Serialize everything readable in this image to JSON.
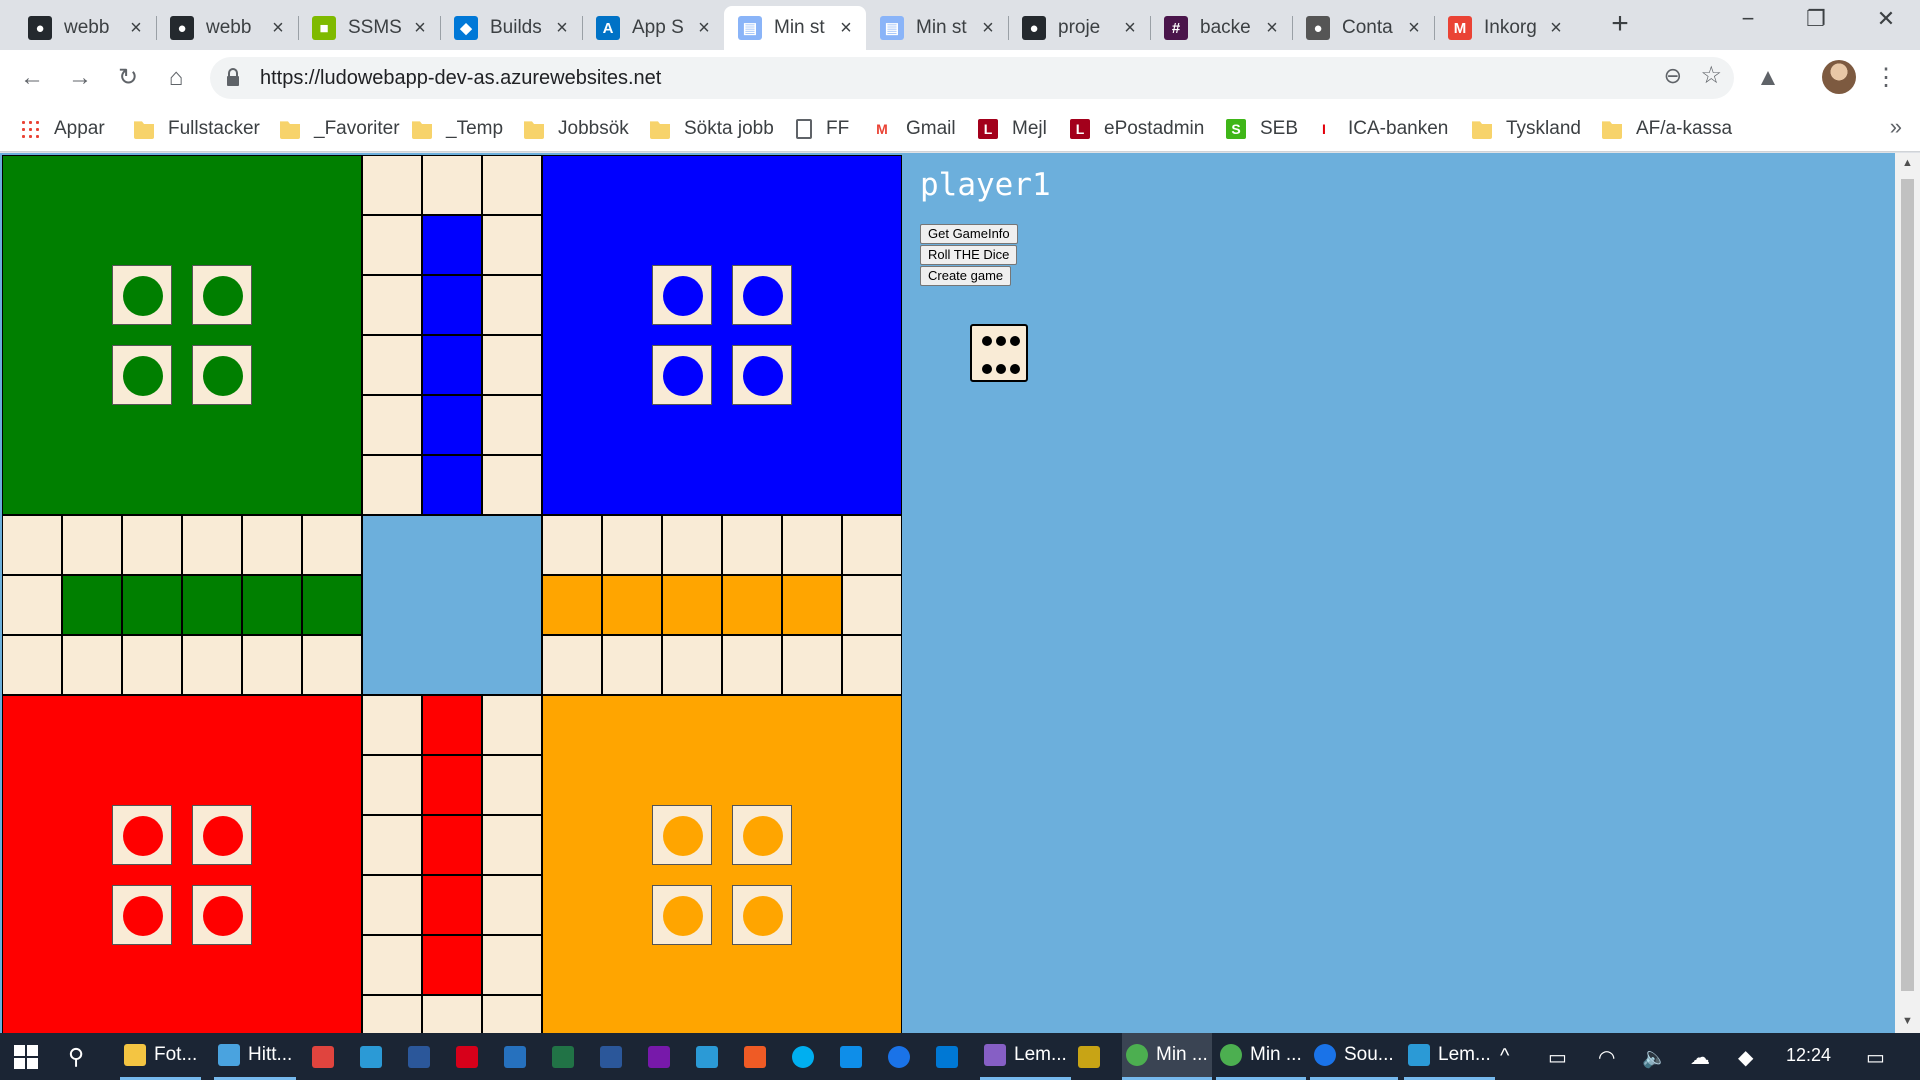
{
  "browser": {
    "tabs": [
      {
        "title": "webb",
        "icon": "github-icon",
        "active": false
      },
      {
        "title": "webb",
        "icon": "github-icon",
        "active": false
      },
      {
        "title": "SSMS",
        "icon": "microsoft-icon",
        "active": false
      },
      {
        "title": "Builds",
        "icon": "azure-devops-icon",
        "active": false
      },
      {
        "title": "App S",
        "icon": "azure-icon",
        "active": false
      },
      {
        "title": "Min st",
        "icon": "page-icon",
        "active": true
      },
      {
        "title": "Min st",
        "icon": "page-icon",
        "active": false
      },
      {
        "title": "proje",
        "icon": "github-icon",
        "active": false
      },
      {
        "title": "backe",
        "icon": "slack-icon",
        "active": false
      },
      {
        "title": "Conta",
        "icon": "apple-icon",
        "active": false
      },
      {
        "title": "Inkorg",
        "icon": "gmail-icon",
        "active": false
      }
    ],
    "url": "https://ludowebapp-dev-as.azurewebsites.net",
    "bookmarks": [
      {
        "label": "Appar",
        "icon": "apps"
      },
      {
        "label": "Fullstacker",
        "icon": "folder"
      },
      {
        "label": "_Favoriter",
        "icon": "folder"
      },
      {
        "label": "_Temp",
        "icon": "folder"
      },
      {
        "label": "Jobbsök",
        "icon": "folder"
      },
      {
        "label": "Sökta jobb",
        "icon": "folder"
      },
      {
        "label": "FF",
        "icon": "doc"
      },
      {
        "label": "Gmail",
        "icon": "gmail"
      },
      {
        "label": "Mejl",
        "icon": "L"
      },
      {
        "label": "ePostadmin",
        "icon": "L"
      },
      {
        "label": "SEB",
        "icon": "seb"
      },
      {
        "label": "ICA-banken",
        "icon": "ica"
      },
      {
        "label": "Tyskland",
        "icon": "folder"
      },
      {
        "label": "AF/a-kassa",
        "icon": "folder"
      }
    ],
    "bookmarks_more": "»"
  },
  "page": {
    "player_name": "player1",
    "buttons": {
      "get_game_info": "Get GameInfo",
      "roll_dice": "Roll THE Dice",
      "create_game": "Create game"
    },
    "dice_value": 6
  },
  "colors": {
    "green": "#007f00",
    "blue": "#0000ff",
    "red": "#ff0000",
    "orange": "#ffa500",
    "square": "#f9ebd6",
    "background": "#6cafdc"
  },
  "taskbar": {
    "items": [
      {
        "label": "Fot...",
        "icon": "explorer-icon",
        "state": "open"
      },
      {
        "label": "Hitt...",
        "icon": "network-icon",
        "state": "open"
      },
      {
        "label": "",
        "icon": "tool-icon",
        "state": "pinned"
      },
      {
        "label": "",
        "icon": "app-icon",
        "state": "pinned"
      },
      {
        "label": "",
        "icon": "word-icon",
        "state": "pinned"
      },
      {
        "label": "",
        "icon": "acrobat-icon",
        "state": "pinned"
      },
      {
        "label": "",
        "icon": "powershell-icon",
        "state": "pinned"
      },
      {
        "label": "",
        "icon": "excel-icon",
        "state": "pinned"
      },
      {
        "label": "",
        "icon": "word-icon",
        "state": "pinned"
      },
      {
        "label": "",
        "icon": "onenote-icon",
        "state": "pinned"
      },
      {
        "label": "",
        "icon": "app-icon",
        "state": "pinned"
      },
      {
        "label": "",
        "icon": "postman-icon",
        "state": "pinned"
      },
      {
        "label": "",
        "icon": "skype-icon",
        "state": "pinned"
      },
      {
        "label": "",
        "icon": "teamviewer-icon",
        "state": "pinned"
      },
      {
        "label": "",
        "icon": "maps-icon",
        "state": "pinned"
      },
      {
        "label": "",
        "icon": "vscode-icon",
        "state": "pinned"
      },
      {
        "label": "Lem...",
        "icon": "visual-studio-icon",
        "state": "open"
      },
      {
        "label": "",
        "icon": "sql-icon",
        "state": "pinned"
      },
      {
        "label": "Min ...",
        "icon": "chrome-icon",
        "state": "active"
      },
      {
        "label": "Min ...",
        "icon": "chrome-icon",
        "state": "open"
      },
      {
        "label": "Sou...",
        "icon": "maps-icon",
        "state": "open"
      },
      {
        "label": "Lem...",
        "icon": "app-icon",
        "state": "open"
      }
    ],
    "clock": "12:24"
  }
}
